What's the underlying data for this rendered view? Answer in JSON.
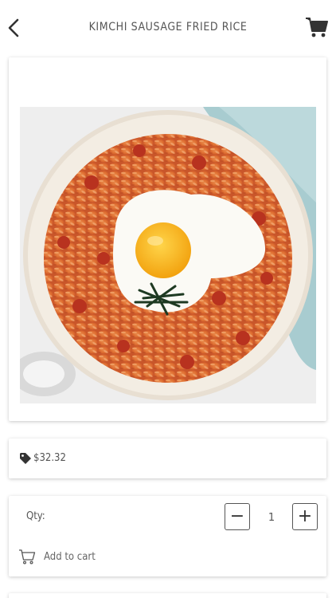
{
  "header": {
    "title": "KIMCHI SAUSAGE FRIED RICE",
    "back_icon": "chevron-left-icon",
    "cart_icon": "shopping-cart-icon"
  },
  "product": {
    "image_alt": "Kimchi sausage fried rice topped with a fried egg and seaweed",
    "price": "$32.32",
    "price_icon": "price-tag-icon"
  },
  "quantity": {
    "label": "Qty:",
    "value": "1",
    "minus_label": "−",
    "plus_label": "+"
  },
  "actions": {
    "add_to_cart_label": "Add to cart",
    "add_to_cart_icon": "cart-outline-icon"
  },
  "colors": {
    "accent": "#333333",
    "card_shadow": "#cccccc",
    "egg_yolk": "#f6b21a",
    "rice": "#e0703a"
  }
}
